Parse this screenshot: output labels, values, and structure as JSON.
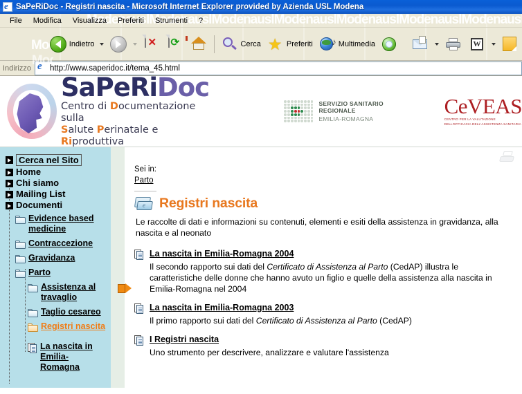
{
  "window": {
    "title": "SaPeRiDoc - Registri nascita - Microsoft Internet Explorer provided by Azienda USL Modena",
    "app_icon": "ie-icon",
    "watermark": "ModenauslModenauslModenauslModenauslModenauslModenauslModenauslModenausl"
  },
  "menubar": {
    "items": [
      {
        "label": "File"
      },
      {
        "label": "Modifica"
      },
      {
        "label": "Visualizza"
      },
      {
        "label": "Preferiti"
      },
      {
        "label": "Strumenti"
      },
      {
        "label": "?"
      }
    ]
  },
  "toolbar": {
    "back_label": "Indietro",
    "search_label": "Cerca",
    "favorites_label": "Preferiti",
    "media_label": "Multimedia",
    "word_glyph": "W",
    "icons": [
      "back-arrow-icon",
      "forward-arrow-icon",
      "stop-icon",
      "refresh-icon",
      "home-icon",
      "search-icon",
      "favorites-star-icon",
      "media-icon",
      "history-icon",
      "mail-icon",
      "print-icon",
      "edit-word-icon",
      "notes-icon"
    ]
  },
  "address_bar": {
    "label": "Indirizzo",
    "url": "http://www.saperidoc.it/tema_45.html",
    "placeholder": "http://"
  },
  "branding": {
    "logo_title_dark": "SaPeRi",
    "logo_title_light": "Doc",
    "tagline_line1_pre": "Centro di ",
    "tagline_line1_accent": "D",
    "tagline_line1_post": "ocumentazione sulla",
    "tagline_line2_a": "S",
    "tagline_line2_b": "alute ",
    "tagline_line2_c": "P",
    "tagline_line2_d": "erinatale e ",
    "tagline_line2_e": "Ri",
    "tagline_line2_f": "produttiva",
    "ssr_line1": "SERVIZIO SANITARIO REGIONALE",
    "ssr_line2": "EMILIA-ROMAGNA",
    "ceveas_title": "CeVEAS",
    "ceveas_sub1": "CENTRO PER LA VALUTAZIONE",
    "ceveas_sub2": "DELL'EFFICACIA DELL'ASSISTENZA SANITARIA",
    "colors": {
      "accent_orange": "#e8781f",
      "logo_dark": "#2d2f63",
      "logo_light": "#6a5fa8",
      "ceveas_red": "#ad1f23",
      "sidebar_blue": "#b7dfe9"
    }
  },
  "sidebar": {
    "top_items": [
      {
        "label": "Cerca nel Sito",
        "boxed": true,
        "icon": "square-arrow-bullet-icon"
      },
      {
        "label": "Home",
        "boxed": false,
        "icon": "square-arrow-bullet-icon"
      },
      {
        "label": "Chi  siamo",
        "boxed": false,
        "icon": "square-arrow-bullet-icon"
      },
      {
        "label": "Mailing List",
        "boxed": false,
        "icon": "square-arrow-bullet-icon"
      },
      {
        "label": "Documenti",
        "boxed": false,
        "icon": "square-arrow-bullet-icon"
      }
    ],
    "tree": [
      {
        "label": "Evidence based medicine",
        "level": 1,
        "icon": "folder-icon",
        "current": false,
        "type": "folder"
      },
      {
        "label": "Contraccezione",
        "level": 1,
        "icon": "folder-icon",
        "current": false,
        "type": "folder"
      },
      {
        "label": "Gravidanza",
        "level": 1,
        "icon": "folder-icon",
        "current": false,
        "type": "folder"
      },
      {
        "label": "Parto",
        "level": 1,
        "icon": "folder-icon",
        "current": false,
        "type": "folder"
      },
      {
        "label": "Assistenza al travaglio",
        "level": 2,
        "icon": "folder-icon",
        "current": false,
        "type": "folder"
      },
      {
        "label": "Taglio cesareo",
        "level": 2,
        "icon": "folder-icon",
        "current": false,
        "type": "folder"
      },
      {
        "label": "Registri nascita",
        "level": 2,
        "icon": "folder-open-icon",
        "current": true,
        "type": "folder"
      },
      {
        "label": "La nascita in Emilia-Romagna",
        "level": 2,
        "icon": "document-icon",
        "current": false,
        "type": "document"
      }
    ],
    "marker_icon": "orange-arrow-marker-icon"
  },
  "breadcrumb": {
    "label": "Sei in:",
    "link": "Parto"
  },
  "content": {
    "page_icon": "open-folder-icon",
    "title": "Registri nascita",
    "intro": "Le raccolte di dati e informazioni su contenuti, elementi e esiti della assistenza in gravidanza, alla nascita e al neonato",
    "print_icon": "print-page-icon",
    "entries": [
      {
        "icon": "document-stack-icon",
        "link": "La nascita in Emilia-Romagna 2004",
        "desc_pre": "Il secondo rapporto sui dati del ",
        "desc_italic": "Certificato di Assistenza al Parto",
        "desc_post": " (CedAP) illustra le caratteristiche delle donne che hanno avuto un figlio e quelle della assistenza alla nascita in Emilia-Romagna nel 2004"
      },
      {
        "icon": "document-stack-icon",
        "link": "La nascita in Emilia-Romagna 2003",
        "desc_pre": "Il primo rapporto sui dati del ",
        "desc_italic": "Certificato di Assistenza al Parto",
        "desc_post": " (CedAP)"
      },
      {
        "icon": "document-stack-icon",
        "link": "I Registri nascita",
        "desc_pre": "Uno strumento per descrivere, analizzare e valutare l'assistenza",
        "desc_italic": "",
        "desc_post": ""
      }
    ]
  }
}
